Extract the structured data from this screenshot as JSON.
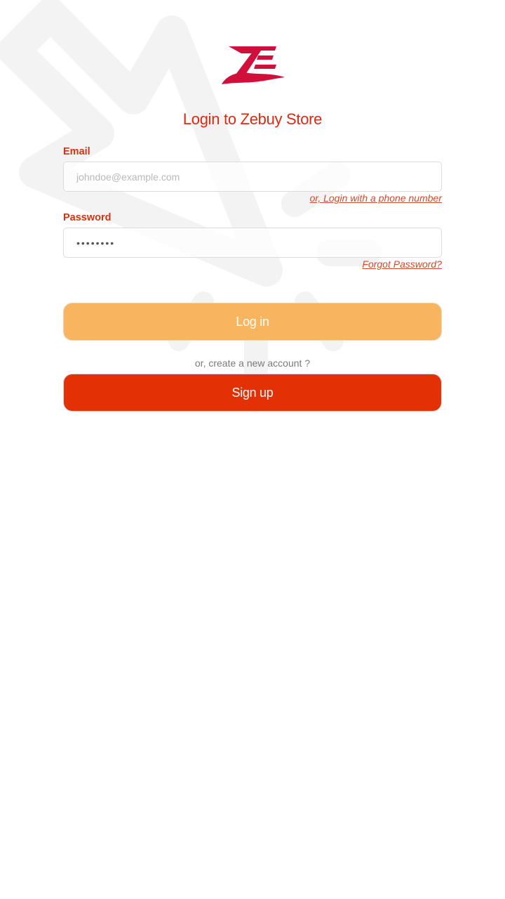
{
  "app": {
    "title": "Login to Zebuy Store",
    "brand_color": "#d0103a",
    "accent_color": "#dc2a10",
    "logo_icon": "zebuy-logo"
  },
  "form": {
    "email": {
      "label": "Email",
      "placeholder": "johndoe@example.com",
      "value": ""
    },
    "phone_login_link": "or, Login with a phone number",
    "password": {
      "label": "Password",
      "masked_value": "••••••••"
    },
    "forgot_password_link": "Forgot Password?",
    "login_button": "Log in",
    "login_button_color": "#f6b55e",
    "create_account_text": "or, create a new account ?",
    "signup_button": "Sign up",
    "signup_button_color": "#e43005"
  }
}
